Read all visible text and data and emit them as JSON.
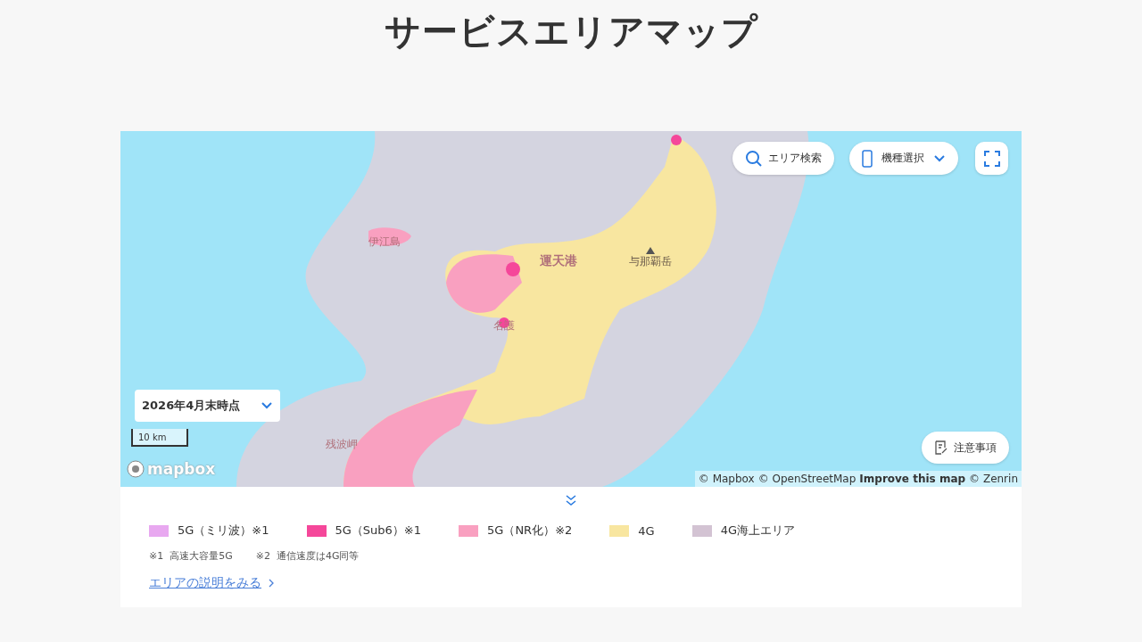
{
  "title": "サービスエリアマップ",
  "map": {
    "search_button": "エリア検索",
    "device_select": "機種選択",
    "date_select": "2026年4月末時点",
    "scale": "10 km",
    "notes_button": "注意事項",
    "logo": "mapbox",
    "place_labels": [
      {
        "text": "伊江島",
        "kind": "place"
      },
      {
        "text": "運天港",
        "kind": "port"
      },
      {
        "text": "与那覇岳",
        "kind": "peak"
      },
      {
        "text": "名護",
        "kind": "place"
      },
      {
        "text": "残波岬",
        "kind": "place"
      }
    ],
    "attribution": [
      {
        "text": "© Mapbox",
        "bold": false
      },
      {
        "text": "© OpenStreetMap",
        "bold": false
      },
      {
        "text": "Improve this map",
        "bold": true
      },
      {
        "text": "© Zenrin",
        "bold": false
      }
    ]
  },
  "legend": {
    "items": [
      {
        "label": "5G（ミリ波）※1",
        "color": "#e8a8f0"
      },
      {
        "label": "5G（Sub6）※1",
        "color": "#f5479a"
      },
      {
        "label": "5G（NR化）※2",
        "color": "#f9a0c0"
      },
      {
        "label": "4G",
        "color": "#f8e6a0"
      },
      {
        "label": "4G海上エリア",
        "color": "#d3c3d3"
      }
    ],
    "notes": [
      "※1  高速大容量5G",
      "※2  通信速度は4G同等"
    ],
    "link": "エリアの説明をみる"
  }
}
